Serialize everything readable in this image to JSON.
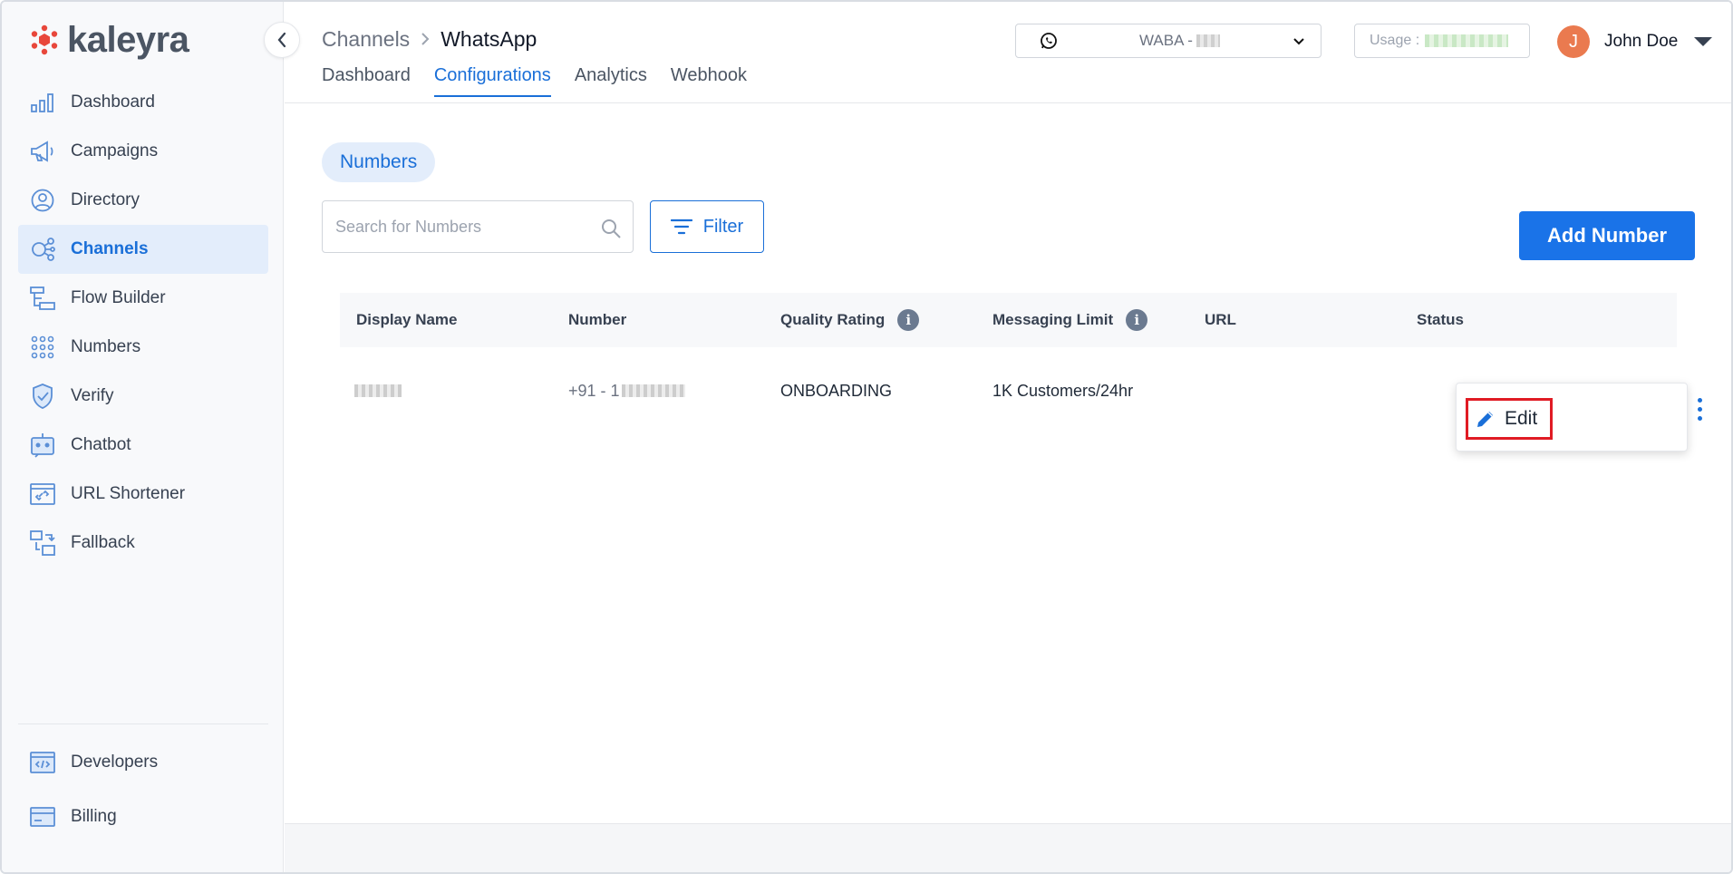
{
  "brand": {
    "name": "kaleyra",
    "accent": "#1a6fd8",
    "logo_color": "#e8473b"
  },
  "sidebar": {
    "items": [
      {
        "label": "Dashboard",
        "icon": "bar-chart-icon"
      },
      {
        "label": "Campaigns",
        "icon": "megaphone-icon"
      },
      {
        "label": "Directory",
        "icon": "contact-icon"
      },
      {
        "label": "Channels",
        "icon": "channels-icon",
        "active": true
      },
      {
        "label": "Flow Builder",
        "icon": "flow-icon"
      },
      {
        "label": "Numbers",
        "icon": "dialpad-icon"
      },
      {
        "label": "Verify",
        "icon": "shield-check-icon"
      },
      {
        "label": "Chatbot",
        "icon": "robot-icon"
      },
      {
        "label": "URL Shortener",
        "icon": "link-icon"
      },
      {
        "label": "Fallback",
        "icon": "fallback-icon"
      }
    ],
    "bottom_items": [
      {
        "label": "Developers",
        "icon": "code-icon"
      },
      {
        "label": "Billing",
        "icon": "credit-card-icon"
      }
    ]
  },
  "header": {
    "breadcrumb": {
      "parent": "Channels",
      "current": "WhatsApp"
    },
    "tabs": [
      "Dashboard",
      "Configurations",
      "Analytics",
      "Webhook"
    ],
    "active_tab": "Configurations",
    "waba_label": "WABA -",
    "usage_label": "Usage :",
    "user": {
      "initial": "J",
      "name": "John Doe"
    }
  },
  "main": {
    "section_pill": "Numbers",
    "search_placeholder": "Search for Numbers",
    "filter_label": "Filter",
    "add_button": "Add Number",
    "table": {
      "columns": [
        "Display Name",
        "Number",
        "Quality Rating",
        "Messaging Limit",
        "URL",
        "Status"
      ],
      "rows": [
        {
          "display_name": "",
          "number_prefix": "+91 - 1",
          "quality_rating": "ONBOARDING",
          "messaging_limit": "1K Customers/24hr",
          "url": ""
        }
      ]
    },
    "context_menu": {
      "edit_label": "Edit"
    }
  }
}
